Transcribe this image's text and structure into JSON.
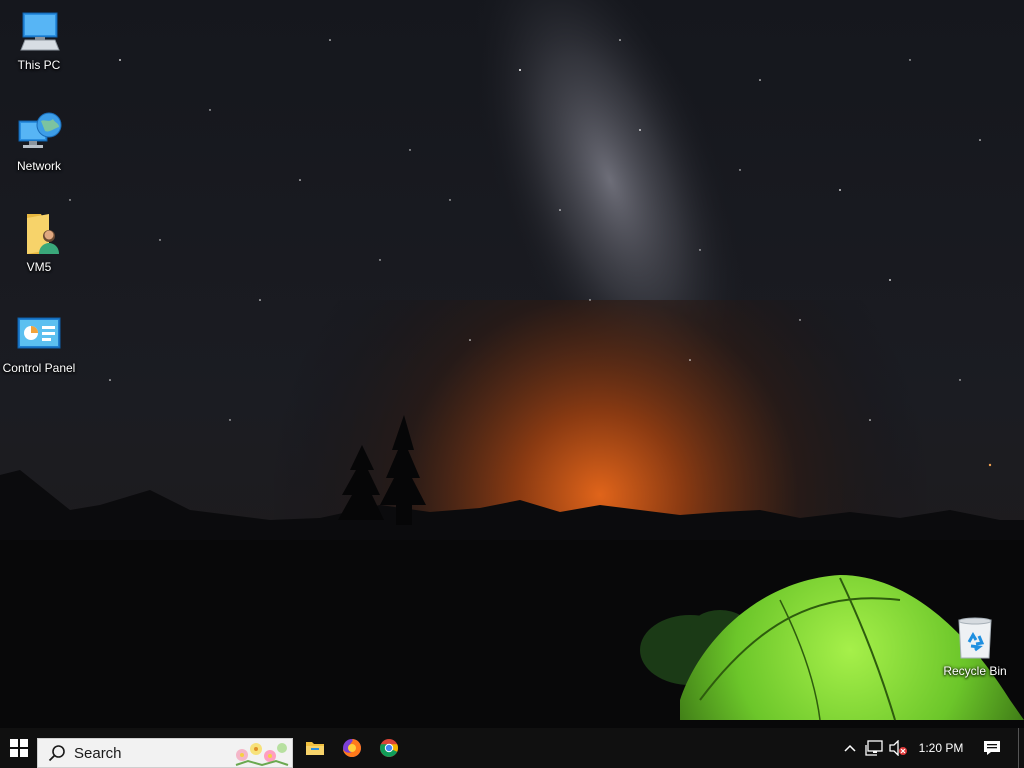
{
  "desktop": {
    "icons": [
      {
        "label": "This PC",
        "icon": "this-pc-icon"
      },
      {
        "label": "Network",
        "icon": "network-icon"
      },
      {
        "label": "VM5",
        "icon": "user-folder-icon"
      },
      {
        "label": "Control Panel",
        "icon": "control-panel-icon"
      },
      {
        "label": "Recycle Bin",
        "icon": "recycle-bin-icon"
      }
    ]
  },
  "taskbar": {
    "search_placeholder": "Search",
    "pinned": [
      {
        "icon": "file-explorer-icon"
      },
      {
        "icon": "firefox-icon"
      },
      {
        "icon": "chrome-icon"
      }
    ],
    "tray": {
      "time": "1:20 PM",
      "icons": [
        "chevron-up-icon",
        "network-tray-icon",
        "volume-muted-icon",
        "notifications-icon"
      ]
    }
  },
  "colors": {
    "taskbar_bg": "#101010",
    "search_bg": "#f2f2f2",
    "tent_green": "#8ee63a",
    "horizon_glow": "#d9601c"
  }
}
